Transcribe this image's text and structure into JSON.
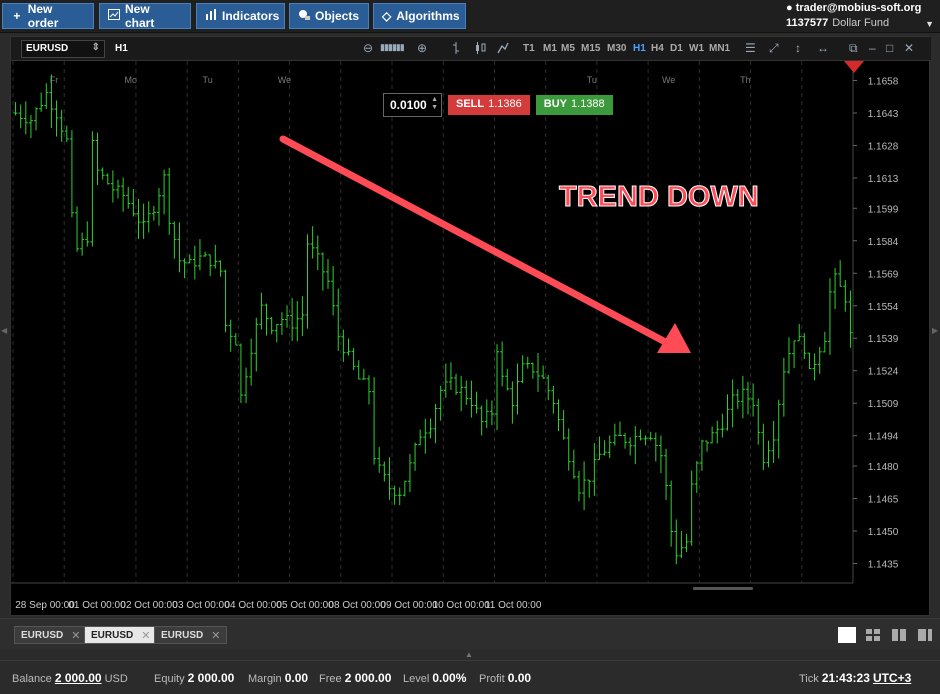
{
  "toolbar": {
    "new_order": "New order",
    "new_chart": "New chart",
    "indicators": "Indicators",
    "objects": "Objects",
    "algorithms": "Algorithms"
  },
  "account": {
    "user": "trader@mobius-soft.org",
    "number": "1137577",
    "fund": "Dollar Fund"
  },
  "chart_toolbar": {
    "symbol": "EURUSD",
    "timeframe": "H1",
    "timeframes": [
      "T1",
      "M1",
      "M5",
      "M15",
      "M30",
      "H1",
      "H4",
      "D1",
      "W1",
      "MN1"
    ],
    "active_timeframe": "H1"
  },
  "order_panel": {
    "lot": "0.0100",
    "sell_label": "SELL",
    "sell_price": "1.1386",
    "buy_label": "BUY",
    "buy_price": "1.1388"
  },
  "annotation": {
    "text": "TREND DOWN",
    "color": "#ff4b55"
  },
  "colors": {
    "candle": "#2fd12f",
    "accent": "#2a5d96",
    "sell": "#d43b3b",
    "buy": "#3c9a3c"
  },
  "chart_data": {
    "type": "bar",
    "y_ticks": [
      "1.1658",
      "1.1643",
      "1.1628",
      "1.1613",
      "1.1599",
      "1.1584",
      "1.1569",
      "1.1554",
      "1.1539",
      "1.1524",
      "1.1509",
      "1.1494",
      "1.1480",
      "1.1465",
      "1.1450",
      "1.1435"
    ],
    "day_labels": [
      "Fr",
      "Mo",
      "Tu",
      "We",
      "Tu",
      "We",
      "Th"
    ],
    "x_labels": [
      "28 Sep 00:00",
      "01 Oct 00:00",
      "02 Oct 00:00",
      "03 Oct 00:00",
      "04 Oct 00:00",
      "05 Oct 00:00",
      "08 Oct 00:00",
      "09 Oct 00:00",
      "10 Oct 00:00",
      "11 Oct 00:00"
    ],
    "ylim": [
      1.1426,
      1.1667
    ],
    "grid": true,
    "path": [
      [
        0,
        1.1643
      ],
      [
        3,
        1.164
      ],
      [
        6,
        1.1652
      ],
      [
        8,
        1.1643
      ],
      [
        10,
        1.163
      ],
      [
        11,
        1.1594
      ],
      [
        12,
        1.158
      ],
      [
        14,
        1.1586
      ],
      [
        15,
        1.1628
      ],
      [
        16,
        1.1616
      ],
      [
        19,
        1.1608
      ],
      [
        21,
        1.1605
      ],
      [
        23,
        1.1598
      ],
      [
        25,
        1.159
      ],
      [
        27,
        1.16
      ],
      [
        29,
        1.1613
      ],
      [
        30,
        1.1595
      ],
      [
        32,
        1.1575
      ],
      [
        34,
        1.1573
      ],
      [
        36,
        1.1576
      ],
      [
        38,
        1.1575
      ],
      [
        40,
        1.157
      ],
      [
        41,
        1.1545
      ],
      [
        43,
        1.1538
      ],
      [
        44,
        1.1512
      ],
      [
        46,
        1.1535
      ],
      [
        48,
        1.1553
      ],
      [
        50,
        1.1545
      ],
      [
        52,
        1.1548
      ],
      [
        54,
        1.1546
      ],
      [
        56,
        1.155
      ],
      [
        57,
        1.1583
      ],
      [
        59,
        1.1575
      ],
      [
        61,
        1.1565
      ],
      [
        63,
        1.154
      ],
      [
        65,
        1.153
      ],
      [
        67,
        1.152
      ],
      [
        69,
        1.1515
      ],
      [
        70,
        1.1485
      ],
      [
        71,
        1.1478
      ],
      [
        73,
        1.147
      ],
      [
        75,
        1.1468
      ],
      [
        77,
        1.148
      ],
      [
        79,
        1.1495
      ],
      [
        81,
        1.15
      ],
      [
        83,
        1.1515
      ],
      [
        85,
        1.1518
      ],
      [
        87,
        1.1515
      ],
      [
        89,
        1.151
      ],
      [
        91,
        1.15
      ],
      [
        93,
        1.1505
      ],
      [
        94,
        1.1535
      ],
      [
        95,
        1.152
      ],
      [
        97,
        1.151
      ],
      [
        99,
        1.1525
      ],
      [
        101,
        1.1525
      ],
      [
        103,
        1.152
      ],
      [
        105,
        1.151
      ],
      [
        107,
        1.1492
      ],
      [
        109,
        1.1478
      ],
      [
        110,
        1.147
      ],
      [
        112,
        1.1475
      ],
      [
        114,
        1.1485
      ],
      [
        116,
        1.149
      ],
      [
        118,
        1.1493
      ],
      [
        120,
        1.1492
      ],
      [
        122,
        1.1495
      ],
      [
        124,
        1.1495
      ],
      [
        126,
        1.1485
      ],
      [
        127,
        1.147
      ],
      [
        128,
        1.145
      ],
      [
        129,
        1.144
      ],
      [
        131,
        1.1445
      ],
      [
        132,
        1.147
      ],
      [
        134,
        1.149
      ],
      [
        136,
        1.1494
      ],
      [
        138,
        1.15
      ],
      [
        140,
        1.151
      ],
      [
        142,
        1.1513
      ],
      [
        144,
        1.151
      ],
      [
        145,
        1.1495
      ],
      [
        146,
        1.1484
      ],
      [
        148,
        1.1495
      ],
      [
        150,
        1.1525
      ],
      [
        152,
        1.154
      ],
      [
        154,
        1.1535
      ],
      [
        155,
        1.1522
      ],
      [
        157,
        1.1535
      ],
      [
        158,
        1.154
      ],
      [
        159,
        1.156
      ],
      [
        160,
        1.1566
      ],
      [
        162,
        1.1558
      ],
      [
        163,
        1.154
      ]
    ]
  },
  "bottom_tabs": [
    "EURUSD",
    "EURUSD",
    "EURUSD"
  ],
  "active_tab": 1,
  "status": {
    "balance_label": "Balance",
    "balance": "2 000.00",
    "currency": "USD",
    "equity_label": "Equity",
    "equity": "2 000.00",
    "margin_label": "Margin",
    "margin": "0.00",
    "free_label": "Free",
    "free": "2 000.00",
    "level_label": "Level",
    "level": "0.00%",
    "profit_label": "Profit",
    "profit": "0.00",
    "tick_label": "Tick",
    "time": "21:43:23",
    "tz": "UTC+3"
  }
}
